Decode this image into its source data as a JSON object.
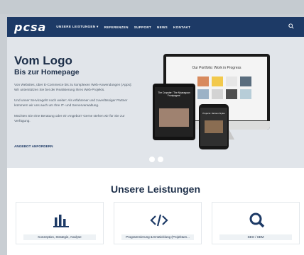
{
  "header": {
    "logo": "pcsa",
    "menu": [
      {
        "label": "UNSERE LEISTUNGEN",
        "has_dropdown": true
      },
      {
        "label": "REFERENZEN"
      },
      {
        "label": "SUPPORT"
      },
      {
        "label": "NEWS"
      },
      {
        "label": "KONTAKT"
      }
    ],
    "search_icon": "search-icon"
  },
  "hero": {
    "title": "Vom Logo",
    "subtitle": "Bis zur Homepage",
    "paragraph_1": "Von Websites, über E-Commerce bis zu komplexen Web-Anwendungen (Apps): Wir unterstützen Sie bei der Realisierung Ihres Web-Projekts.",
    "paragraph_2": "Und unser Servicegeht noch weiter: Als erfahrener und zuverlässiger Partner kümmern wir uns auch um Ihre IT- und Serververwaltung.",
    "paragraph_3": "Möchten Sie eine Beratung oder ein Angebot? Gerne stehen wir für Sie zur Verfügung.",
    "cta": "ANGEBOT ANFORDERN",
    "slider_dots": 2
  },
  "devices": {
    "monitor_heading": "Our Portfolio: Work in Progress",
    "tablet_text": "The Cropster: 'The Nicaraguan Frontpagers'",
    "phone_text": "Projects: Various Styles"
  },
  "services": {
    "title": "Unsere Leistungen",
    "items": [
      {
        "label": "Konzeption, Strategie, Analyse",
        "icon": "chart-icon"
      },
      {
        "label": "Programmierung & Entwicklung (Projektum...",
        "icon": "code-icon"
      },
      {
        "label": "SEO / SEM",
        "icon": "search-icon"
      }
    ]
  },
  "colors": {
    "nav_bg": "#1d3a66",
    "hero_bg": "#e1e5ea",
    "text_dark": "#1d2f49"
  }
}
